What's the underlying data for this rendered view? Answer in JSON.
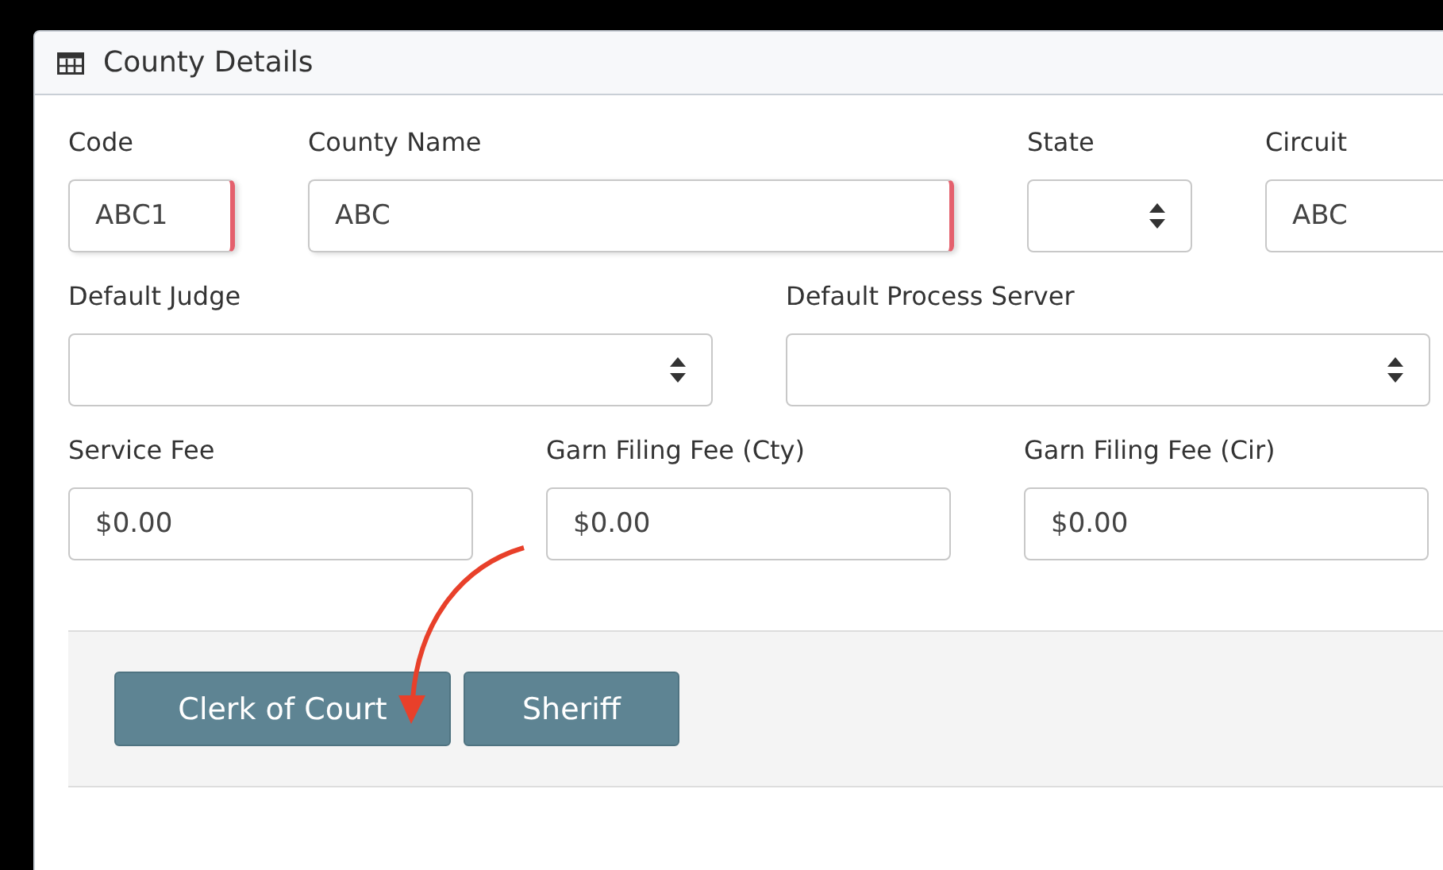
{
  "panel": {
    "title": "County Details"
  },
  "rows": [
    {
      "fields": [
        {
          "label": "Code",
          "kind": "input",
          "value": "ABC1",
          "invalid": true
        },
        {
          "label": "County Name",
          "kind": "input",
          "value": "ABC",
          "invalid": true
        },
        {
          "label": "State",
          "kind": "select",
          "invalid": false
        },
        {
          "label": "Circuit",
          "kind": "input",
          "value": "ABC",
          "invalid": false
        }
      ]
    },
    {
      "fields": [
        {
          "label": "Default Judge",
          "kind": "select",
          "invalid": false
        },
        {
          "label": "Default Process Server",
          "kind": "select",
          "invalid": false
        }
      ]
    },
    {
      "fields": [
        {
          "label": "Service Fee",
          "kind": "input",
          "value": "$0.00",
          "invalid": false
        },
        {
          "label": "Garn Filing Fee (Cty)",
          "kind": "input",
          "value": "$0.00",
          "invalid": false
        },
        {
          "label": "Garn Filing Fee (Cir)",
          "kind": "input",
          "value": "$0.00",
          "invalid": false
        }
      ]
    }
  ],
  "buttons": [
    {
      "label": "Clerk of Court"
    },
    {
      "label": "Sheriff"
    }
  ]
}
